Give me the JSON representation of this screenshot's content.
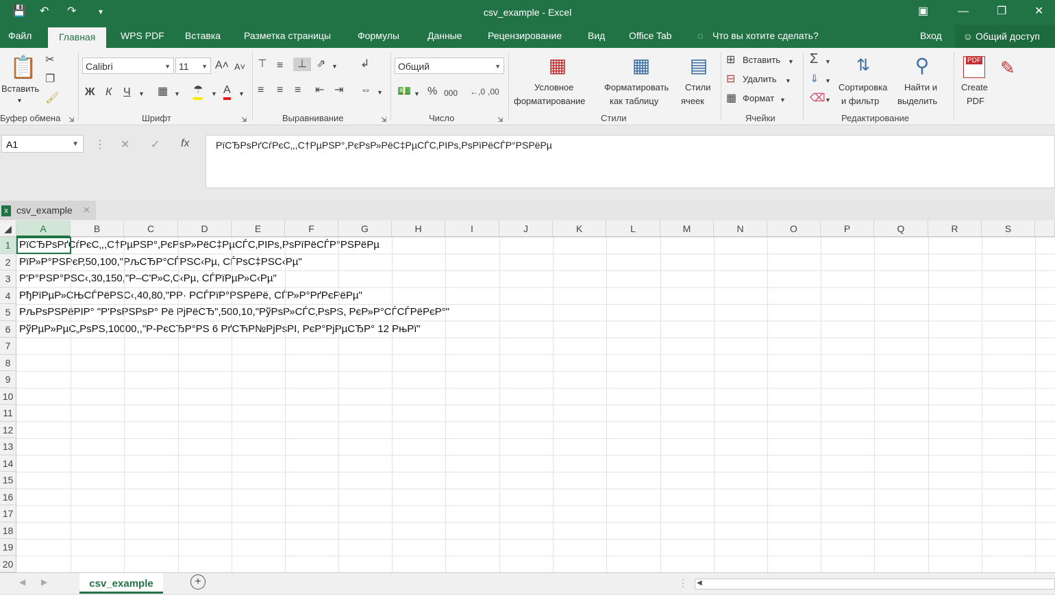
{
  "window": {
    "title": "csv_example - Excel"
  },
  "menu": {
    "tabs": [
      "Файл",
      "Главная",
      "WPS PDF",
      "Вставка",
      "Разметка страницы",
      "Формулы",
      "Данные",
      "Рецензирование",
      "Вид",
      "Office Tab"
    ],
    "active_tab": "Главная",
    "tell_me": "Что вы хотите сделать?",
    "signin": "Вход",
    "share": "Общий доступ"
  },
  "ribbon": {
    "clipboard": {
      "paste": "Вставить",
      "label": "Буфер обмена"
    },
    "font": {
      "name": "Calibri",
      "size": "11",
      "bold": "Ж",
      "italic": "К",
      "underline": "Ч",
      "label": "Шрифт"
    },
    "alignment": {
      "label": "Выравнивание"
    },
    "number": {
      "format": "Общий",
      "percent": "%",
      "thousands": "000",
      "label": "Число"
    },
    "styles": {
      "conditional_line1": "Условное",
      "conditional_line2": "форматирование",
      "format_table_line1": "Форматировать",
      "format_table_line2": "как таблицу",
      "cell_styles_line1": "Стили",
      "cell_styles_line2": "ячеек",
      "label": "Стили"
    },
    "cells": {
      "insert": "Вставить",
      "delete": "Удалить",
      "format": "Формат",
      "label": "Ячейки"
    },
    "editing": {
      "sort_line1": "Сортировка",
      "sort_line2": "и фильтр",
      "find_line1": "Найти и",
      "find_line2": "выделить",
      "label": "Редактирование"
    },
    "pdf": {
      "line1": "Create",
      "line2": "PDF",
      "badge": "PDF"
    }
  },
  "formula_bar": {
    "name_box": "A1",
    "fx": "fx",
    "content": "РїСЂРѕРґСѓРєС‚,,С†РµРЅР°,РєРѕР»РёС‡РµСЃС‚РІРѕ,РѕРїРёСЃР°РЅРёРµ"
  },
  "document_tab": "csv_example",
  "columns": [
    "A",
    "B",
    "C",
    "D",
    "E",
    "F",
    "G",
    "H",
    "I",
    "J",
    "K",
    "L",
    "M",
    "N",
    "O",
    "P",
    "Q",
    "R",
    "S"
  ],
  "rows": [
    "1",
    "2",
    "3",
    "4",
    "5",
    "6",
    "7",
    "8",
    "9",
    "10",
    "11",
    "12",
    "13",
    "14",
    "15",
    "16",
    "17",
    "18",
    "19",
    "20"
  ],
  "cells": [
    "РїСЂРѕРґСѓРєС‚,,С†РµРЅР°,РєРѕР»РёС‡РµСЃС‚РІРѕ,РѕРїРёСЃР°РЅРёРµ",
    "РїР»Р°РЅРєР,50,100,\"РљСЂР°СЃРЅС‹Рµ, СЃРѕС‡РЅС‹Рµ\"",
    "Р'Р°РЅР°РЅС‹,30,150,\"Р–С'Р»С‚С‹Рµ, СЃРїРµР»С‹Рµ\"",
    "РђРїРµР»СЊСЃРёРЅС‹,40,80,\"РР· РСЃРїР°РЅРёРё, СЃР»Р°РґРєРёРµ\"",
    "РљРѕРЅРёРІР° \"Р'РѕРЅРѕР° Рё РјРёСЂ\",500,10,\"РўРѕР»СЃС‚РѕРЅ, РєР»Р°СЃСЃРёРєР°\"",
    "РўРµР»РµС„РѕРЅ,10000,,\"Р-РєСЂР°РЅ 6 РґСЋР№РјРѕРІ, РєР°РјРµСЂР° 12 РњРї\""
  ],
  "sheet_tab": "csv_example",
  "colors": {
    "accent": "#217346",
    "grid": "#d4d4d4"
  }
}
